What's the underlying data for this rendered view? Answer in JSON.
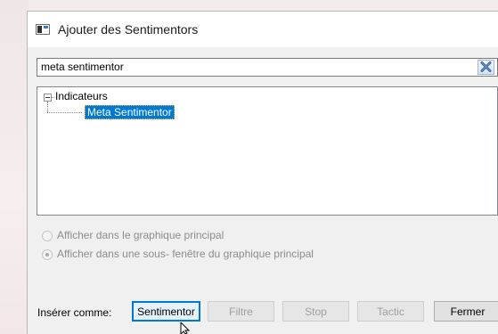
{
  "window": {
    "title": "Ajouter des Sentimentors",
    "icon": "window-icon"
  },
  "search": {
    "value": "meta sentimentor",
    "clear_icon": "close-x-icon"
  },
  "tree": {
    "root_label": "Indicateurs",
    "root_expanded": true,
    "items": [
      {
        "label": "Meta Sentimentor",
        "selected": true
      }
    ]
  },
  "display_options": [
    {
      "label": "Afficher dans le graphique principal",
      "selected": false,
      "enabled": false
    },
    {
      "label": "Afficher dans une sous- fenêtre du graphique principal",
      "selected": true,
      "enabled": false
    }
  ],
  "insert_as": {
    "label": "Insérer comme:",
    "buttons": [
      {
        "label": "Sentimentor",
        "enabled": true,
        "default": true
      },
      {
        "label": "Filtre",
        "enabled": false
      },
      {
        "label": "Stop",
        "enabled": false
      },
      {
        "label": "Tactic",
        "enabled": false
      }
    ]
  },
  "close_button": {
    "label": "Fermer",
    "enabled": true
  },
  "colors": {
    "selection": "#0078d7",
    "dialog_bg": "#f0f0f0",
    "disabled_text": "#9e9e9e"
  }
}
